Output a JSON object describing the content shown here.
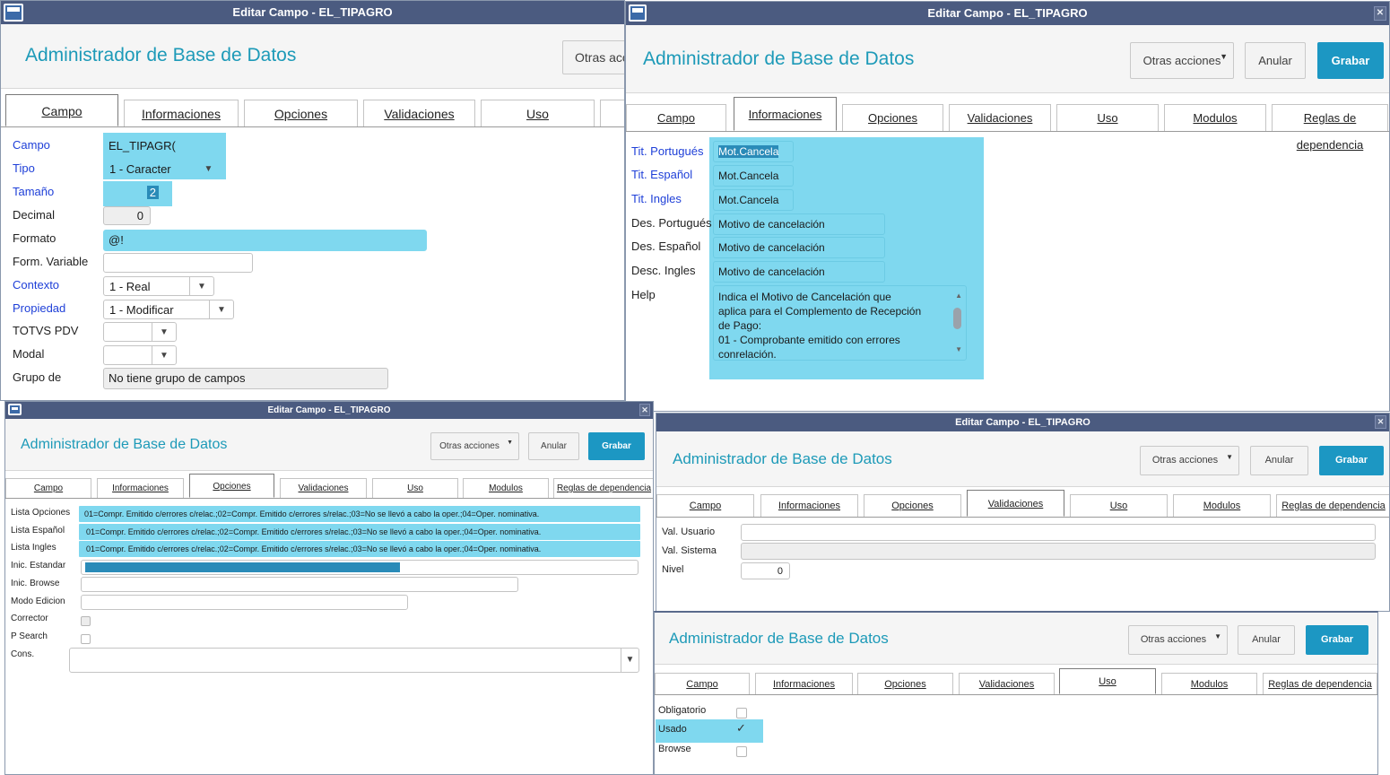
{
  "window_title": "Editar Campo - EL_TIPAGRO",
  "app_title": "Administrador de Base de Datos",
  "buttons": {
    "other": "Otras acciones",
    "other_cut": "Otras acc",
    "cancel": "Anular",
    "save": "Grabar"
  },
  "tabs": {
    "campo": "Campo",
    "informaciones": "Informaciones",
    "opciones": "Opciones",
    "validaciones": "Validaciones",
    "uso": "Uso",
    "modulos": "Modulos",
    "reglas": "Reglas de dependencia"
  },
  "campo": {
    "labels": {
      "campo": "Campo",
      "tipo": "Tipo",
      "tamano": "Tamaño",
      "decimal": "Decimal",
      "formato": "Formato",
      "form_variable": "Form. Variable",
      "contexto": "Contexto",
      "propiedad": "Propiedad",
      "totvs_pdv": "TOTVS PDV",
      "modal": "Modal",
      "grupo": "Grupo de"
    },
    "values": {
      "campo": "EL_TIPAGR(",
      "tipo": "1 - Caracter",
      "tamano": "2",
      "decimal": "0",
      "formato": "@!",
      "form_variable": "",
      "contexto": "1 - Real",
      "propiedad": "1 - Modificar",
      "totvs_pdv": "",
      "modal": "",
      "grupo": "No tiene grupo de campos"
    }
  },
  "informaciones": {
    "labels": {
      "tit_pt": "Tit. Portugués",
      "tit_es": "Tit. Español",
      "tit_en": "Tit. Ingles",
      "des_pt": "Des. Portugués",
      "des_es": "Des. Español",
      "des_en": "Desc. Ingles",
      "help": "Help"
    },
    "values": {
      "tit_pt": "Mot.Cancela",
      "tit_es": "Mot.Cancela",
      "tit_en": "Mot.Cancela",
      "des_pt": "Motivo de cancelación",
      "des_es": "Motivo de cancelación",
      "des_en": "Motivo de cancelación"
    },
    "help_lines": [
      "Indica el Motivo de Cancelación que",
      "aplica para el Complemento de Recepción",
      "de Pago:",
      "01 - Comprobante emitido con errores",
      "conrelación."
    ]
  },
  "opciones": {
    "labels": {
      "lista_op": "Lista Opciones",
      "lista_es": "Lista Español",
      "lista_en": "Lista Ingles",
      "inic_std": "Inic. Estandar",
      "inic_brw": "Inic. Browse",
      "modo": "Modo Edicion",
      "corrector": "Corrector",
      "psearch": "P Search",
      "cons": "Cons."
    },
    "values": {
      "lista_op": "01=Compr. Emitido c/errores c/relac.;02=Compr. Emitido c/errores s/relac.;03=No se llevó a cabo la oper.;04=Oper. nominativa.",
      "lista_es": "01=Compr. Emitido c/errores c/relac.;02=Compr. Emitido c/errores s/relac.;03=No se llevó a cabo la oper.;04=Oper. nominativa.",
      "lista_en": "01=Compr. Emitido c/errores c/relac.;02=Compr. Emitido c/errores s/relac.;03=No se llevó a cabo la oper.;04=Oper. nominativa.",
      "inic_brw": "",
      "modo": "",
      "cons": ""
    }
  },
  "validaciones": {
    "labels": {
      "val_usuario": "Val. Usuario",
      "val_sistema": "Val. Sistema",
      "nivel": "Nivel"
    },
    "values": {
      "val_usuario": "",
      "val_sistema": "",
      "nivel": "0"
    }
  },
  "uso": {
    "labels": {
      "obligatorio": "Obligatorio",
      "usado": "Usado",
      "browse": "Browse"
    },
    "checked": {
      "obligatorio": false,
      "usado": true,
      "browse": false
    }
  },
  "colors": {
    "title_bar": "#4b5b80",
    "accent": "#1d9ab8",
    "primary_button": "#1c97c3",
    "highlight": "#7fd8ef",
    "required_label": "#1e3fd8"
  }
}
